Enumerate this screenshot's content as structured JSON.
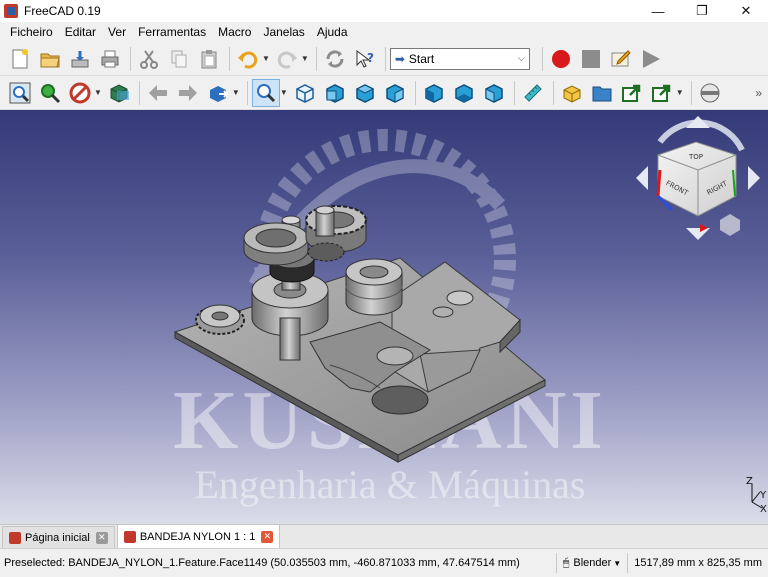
{
  "window": {
    "title": "FreeCAD 0.19",
    "minimize": "—",
    "maximize": "❐",
    "close": "✕"
  },
  "menu": [
    "Ficheiro",
    "Editar",
    "Ver",
    "Ferramentas",
    "Macro",
    "Janelas",
    "Ajuda"
  ],
  "toolbar1": {
    "workbench": "Start",
    "icons": [
      "new-file-icon",
      "open-file-icon",
      "save-icon",
      "print-icon",
      "cut-icon",
      "copy-icon",
      "paste-icon",
      "undo-icon",
      "redo-icon",
      "refresh-icon",
      "whats-this-icon",
      "macro-record-icon",
      "macro-stop-icon",
      "macro-edit-icon",
      "macro-run-icon"
    ]
  },
  "toolbar2": {
    "icons": [
      "fit-all-icon",
      "fit-selection-icon",
      "draw-style-icon",
      "stereo-icon",
      "back-icon",
      "forward-icon",
      "sync-view-icon",
      "zoom-icon",
      "isometric-icon",
      "front-view-icon",
      "top-view-icon",
      "right-view-icon",
      "rear-view-icon",
      "bottom-view-icon",
      "left-view-icon",
      "measure-icon",
      "part-icon",
      "group-icon",
      "link-icon",
      "link-actions-icon",
      "clipping-icon"
    ]
  },
  "viewport": {
    "watermark_title": "KUSMANI",
    "watermark_subtitle": "Engenharia & Máquinas",
    "navcube": {
      "top": "TOP",
      "front": "FRONT",
      "right": "RIGHT"
    },
    "axis": {
      "x": "X",
      "y": "Y",
      "z": "Z"
    },
    "colors": {
      "bg_top": "#343a78",
      "bg_bottom": "#dcdde9",
      "model": "#9a9a9a"
    }
  },
  "tabs": [
    {
      "label": "Página inicial",
      "active": false
    },
    {
      "label": "BANDEJA NYLON 1 : 1",
      "active": true
    }
  ],
  "status": {
    "message": "Preselected: BANDEJA_NYLON_1.Feature.Face1149 (50.035503 mm, -460.871033 mm, 47.647514 mm)",
    "nav_style": "Blender",
    "dimensions": "1517,89 mm x 825,35 mm"
  }
}
